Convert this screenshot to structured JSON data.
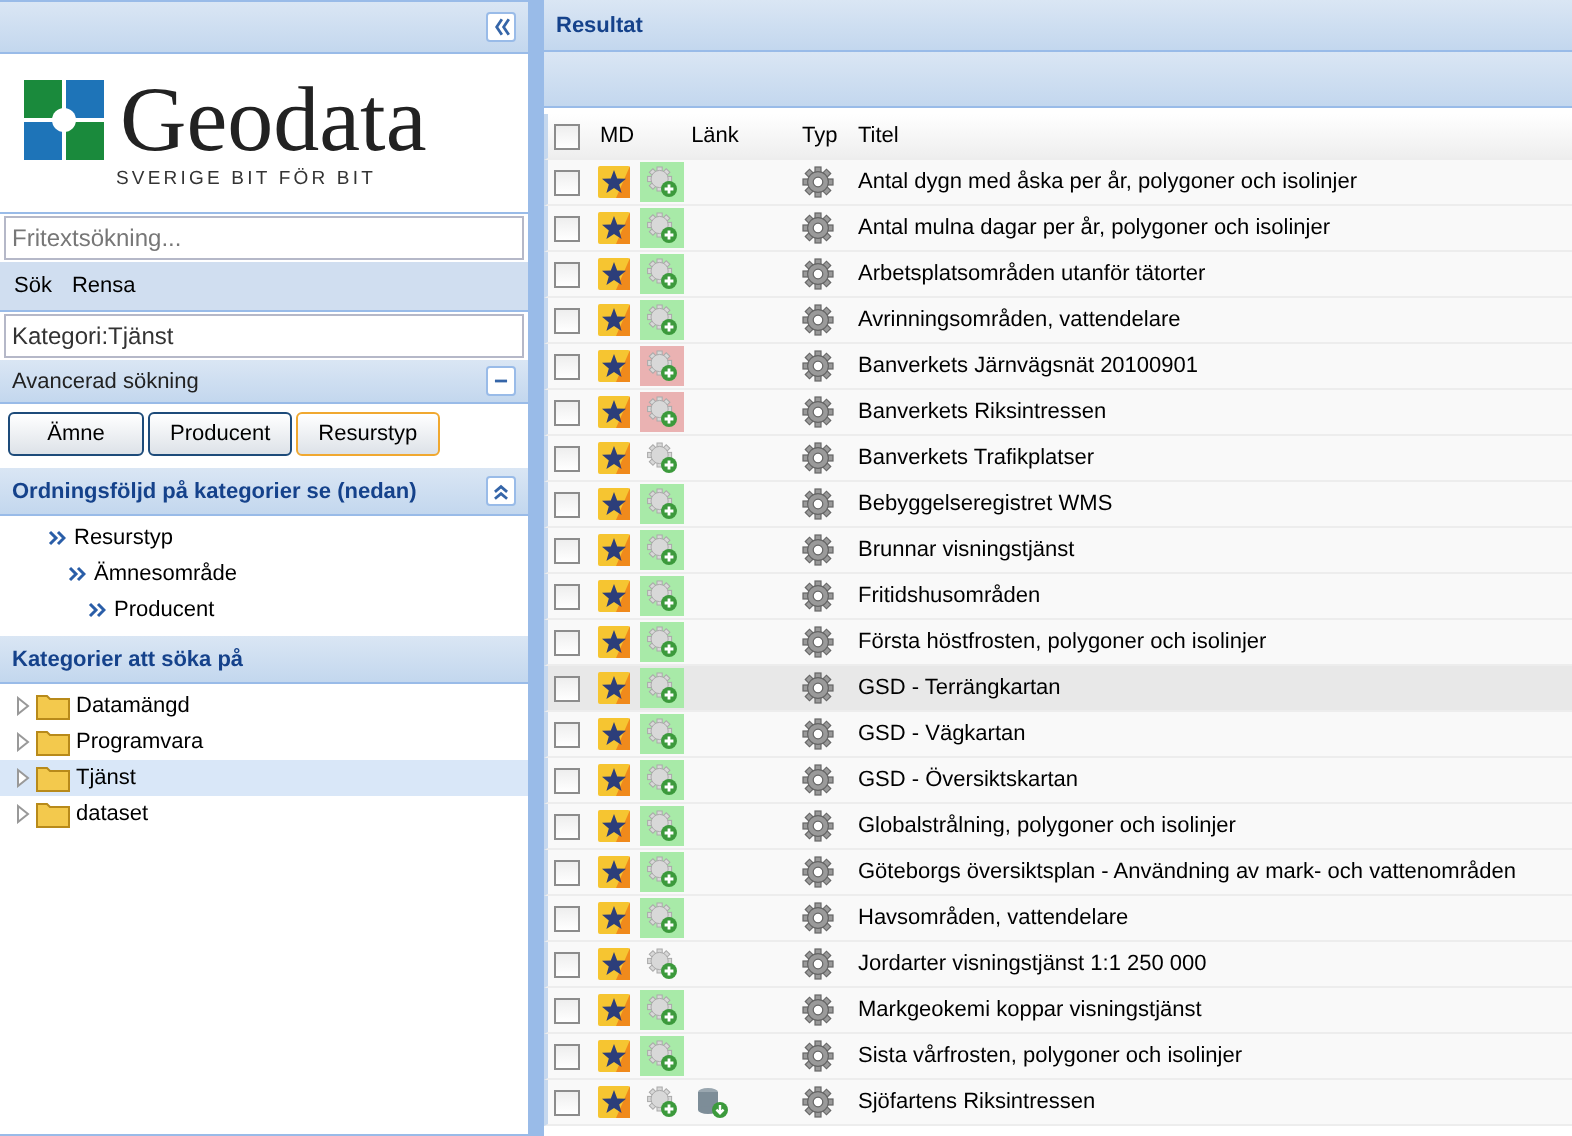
{
  "logo": {
    "name": "Geodata",
    "tagline": "SVERIGE BIT FÖR BIT"
  },
  "search": {
    "placeholder": "Fritextsökning..."
  },
  "search_toolbar": [
    "Sök",
    "Rensa"
  ],
  "category_field": {
    "value": "Kategori:Tjänst"
  },
  "advanced": {
    "title": "Avancerad sökning",
    "expanded": true,
    "buttons": [
      {
        "label": "Ämne",
        "selected": false
      },
      {
        "label": "Producent",
        "selected": false
      },
      {
        "label": "Resurstyp",
        "selected": true
      }
    ]
  },
  "order": {
    "title": "Ordningsföljd på kategorier se (nedan)",
    "expanded": true,
    "tree": [
      {
        "label": "Resurstyp",
        "children": [
          {
            "label": "Ämnesområde",
            "children": [
              {
                "label": "Producent"
              }
            ]
          }
        ]
      }
    ]
  },
  "categories": {
    "title": "Kategorier att söka på",
    "items": [
      {
        "label": "Datamängd",
        "selected": false
      },
      {
        "label": "Programvara",
        "selected": false
      },
      {
        "label": "Tjänst",
        "selected": true
      },
      {
        "label": "dataset",
        "selected": false
      }
    ]
  },
  "results": {
    "title": "Resultat",
    "all_checked": false,
    "columns": [
      "MD",
      "Länk",
      "Typ",
      "Titel"
    ],
    "rows": [
      {
        "title": "Antal dygn med åska per år, polygoner och isolinjer",
        "kind": "ok",
        "download": false,
        "checked": false,
        "selected": false
      },
      {
        "title": "Antal mulna dagar per år, polygoner och isolinjer",
        "kind": "ok",
        "download": false,
        "checked": false,
        "selected": false
      },
      {
        "title": "Arbetsplatsområden utanför tätorter",
        "kind": "ok",
        "download": false,
        "checked": false,
        "selected": false
      },
      {
        "title": "Avrinningsområden, vattendelare",
        "kind": "ok",
        "download": false,
        "checked": false,
        "selected": false
      },
      {
        "title": "Banverkets Järnvägsnät 20100901",
        "kind": "error",
        "download": false,
        "checked": false,
        "selected": false
      },
      {
        "title": "Banverkets Riksintressen",
        "kind": "error",
        "download": false,
        "checked": false,
        "selected": false
      },
      {
        "title": "Banverkets Trafikplatser",
        "kind": "plain",
        "download": false,
        "checked": false,
        "selected": false
      },
      {
        "title": "Bebyggelseregistret WMS",
        "kind": "ok",
        "download": false,
        "checked": false,
        "selected": false
      },
      {
        "title": "Brunnar visningstjänst",
        "kind": "ok",
        "download": false,
        "checked": false,
        "selected": false
      },
      {
        "title": "Fritidshusområden",
        "kind": "ok",
        "download": false,
        "checked": false,
        "selected": false
      },
      {
        "title": "Första höstfrosten, polygoner och isolinjer",
        "kind": "ok",
        "download": false,
        "checked": false,
        "selected": false
      },
      {
        "title": "GSD - Terrängkartan",
        "kind": "ok",
        "download": false,
        "checked": false,
        "selected": true
      },
      {
        "title": "GSD - Vägkartan",
        "kind": "ok",
        "download": false,
        "checked": false,
        "selected": false
      },
      {
        "title": "GSD - Översiktskartan",
        "kind": "ok",
        "download": false,
        "checked": false,
        "selected": false
      },
      {
        "title": "Globalstrålning, polygoner och isolinjer",
        "kind": "ok",
        "download": false,
        "checked": false,
        "selected": false
      },
      {
        "title": "Göteborgs översiktsplan - Användning av mark- och vattenområden",
        "kind": "ok",
        "download": false,
        "checked": false,
        "selected": false
      },
      {
        "title": "Havsområden, vattendelare",
        "kind": "ok",
        "download": false,
        "checked": false,
        "selected": false
      },
      {
        "title": "Jordarter visningstjänst 1:1 250 000",
        "kind": "plain",
        "download": false,
        "checked": false,
        "selected": false
      },
      {
        "title": "Markgeokemi koppar visningstjänst",
        "kind": "ok",
        "download": false,
        "checked": false,
        "selected": false
      },
      {
        "title": "Sista vårfrosten, polygoner och isolinjer",
        "kind": "ok",
        "download": false,
        "checked": false,
        "selected": false
      },
      {
        "title": "Sjöfartens Riksintressen",
        "kind": "plain",
        "download": true,
        "checked": false,
        "selected": false
      }
    ]
  }
}
